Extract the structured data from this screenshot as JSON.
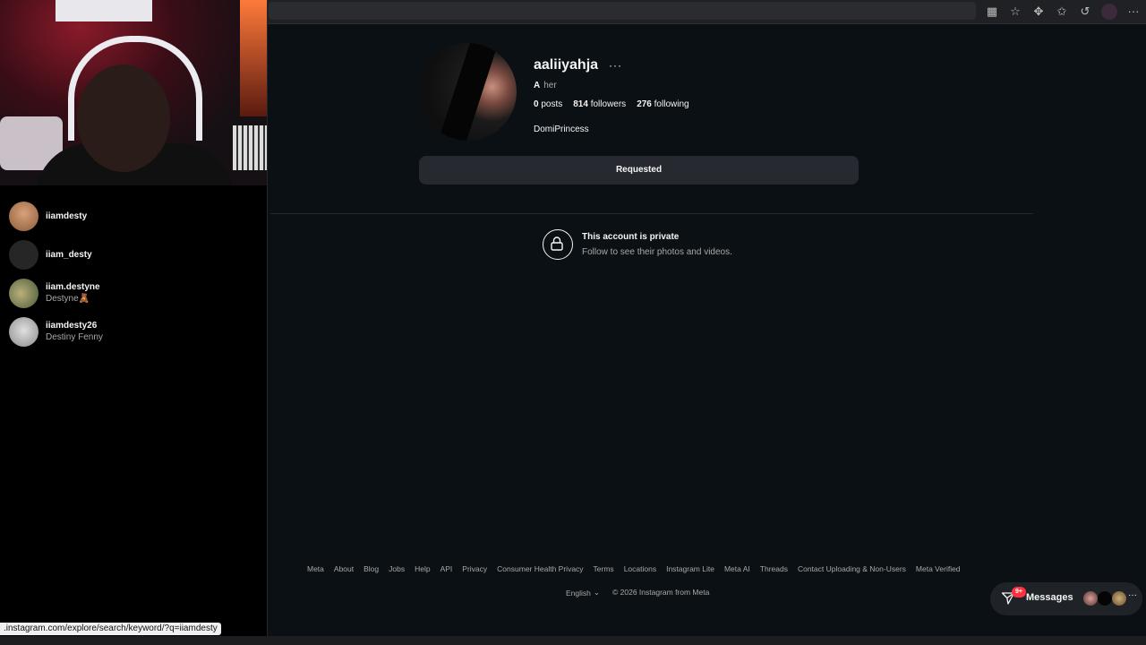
{
  "status_bar_url": ".instagram.com/explore/search/keyword/?q=iiamdesty",
  "search_results": [
    {
      "username": "iiamdesty",
      "subtitle": ""
    },
    {
      "username": "iiam_desty",
      "subtitle": ""
    },
    {
      "username": "iiam.destyne",
      "subtitle": "Destyne🧸"
    },
    {
      "username": "iiamdesty26",
      "subtitle": "Destiny Fenny"
    }
  ],
  "profile": {
    "username": "aaliiyahja",
    "more_icon": "···",
    "threads_glyph": "A",
    "pronouns": "her",
    "posts_count": "0",
    "posts_label": "posts",
    "followers_count": "814",
    "followers_label": "followers",
    "following_count": "276",
    "following_label": "following",
    "full_name": "DomiPrincess",
    "follow_button": "Requested"
  },
  "private_notice": {
    "title": "This account is private",
    "subtitle": "Follow to see their photos and videos."
  },
  "footer": {
    "links": [
      "Meta",
      "About",
      "Blog",
      "Jobs",
      "Help",
      "API",
      "Privacy",
      "Consumer Health Privacy",
      "Terms",
      "Locations",
      "Instagram Lite",
      "Meta AI",
      "Threads",
      "Contact Uploading & Non-Users",
      "Meta Verified"
    ],
    "language": "English",
    "copyright": "© 2026 Instagram from Meta"
  },
  "messages": {
    "label": "Messages",
    "badge": "9+"
  },
  "colors": {
    "background": "#0b1014",
    "button": "#262a30",
    "badge": "#ff3040",
    "muted_text": "#a8a8a8"
  }
}
